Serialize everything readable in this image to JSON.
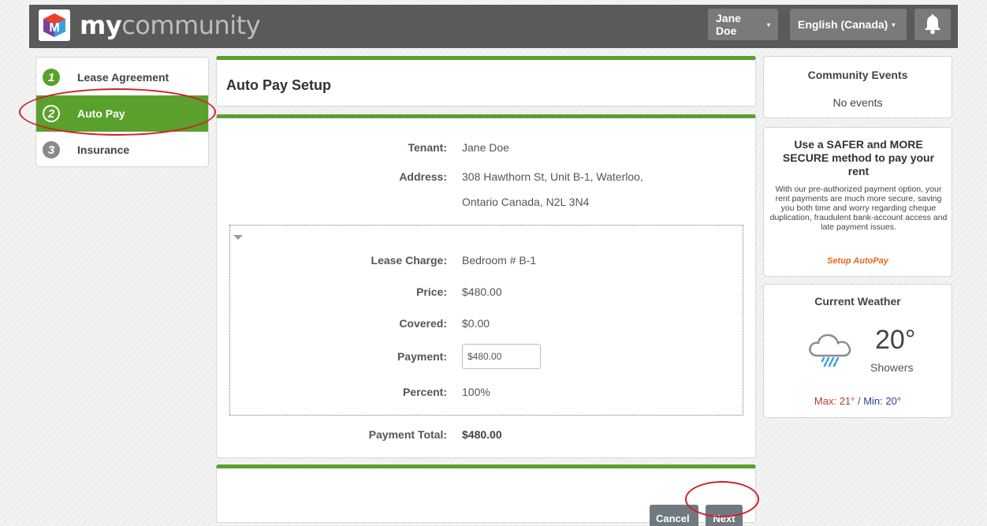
{
  "header": {
    "brand_my": "my",
    "brand_community": "community",
    "user_menu": "Jane Doe",
    "language_menu": "English (Canada)",
    "caret": "▾",
    "icons": {
      "logo": "mycommunity-logo",
      "notifications": "bell-icon"
    }
  },
  "steps": [
    {
      "number": "1",
      "label": "Lease Agreement",
      "state": "completed"
    },
    {
      "number": "2",
      "label": "Auto Pay",
      "state": "active"
    },
    {
      "number": "3",
      "label": "Insurance",
      "state": "pending"
    }
  ],
  "page": {
    "title": "Auto Pay Setup"
  },
  "details": {
    "tenant_label": "Tenant:",
    "tenant_value": "Jane Doe",
    "address_label": "Address:",
    "address_line1": "308 Hawthorn St, Unit B-1, Waterloo,",
    "address_line2": "Ontario Canada, N2L 3N4"
  },
  "charge": {
    "lease_charge_label": "Lease Charge:",
    "lease_charge_value": "Bedroom # B-1",
    "price_label": "Price:",
    "price_value": "$480.00",
    "covered_label": "Covered:",
    "covered_value": "$0.00",
    "payment_label": "Payment:",
    "payment_value": "$480.00",
    "percent_label": "Percent:",
    "percent_value": "100%"
  },
  "totals": {
    "label": "Payment Total:",
    "value": "$480.00"
  },
  "footer": {
    "cancel_label": "Cancel",
    "next_label": "Next"
  },
  "sidebar": {
    "events_title": "Community Events",
    "events_empty": "No events",
    "promo_heading": "Use a SAFER and MORE SECURE method to pay your rent",
    "promo_body": "With our pre-authorized payment option, your rent payments are much more secure, saving you both time and worry regarding cheque duplication, fraudulent bank-account access and late payment issues.",
    "promo_link": "Setup AutoPay",
    "weather_title": "Current Weather",
    "weather_temp": "20°",
    "weather_condition": "Showers",
    "weather_max_label": "Max: 21°",
    "weather_separator": " / ",
    "weather_min_label": "Min: 20°",
    "weather_icon": "rain-cloud-icon"
  },
  "colors": {
    "accent_green": "#5aa02c",
    "header_bg": "#5a5a5a",
    "annotation_red": "#d0202a",
    "link_orange": "#e8651c"
  }
}
